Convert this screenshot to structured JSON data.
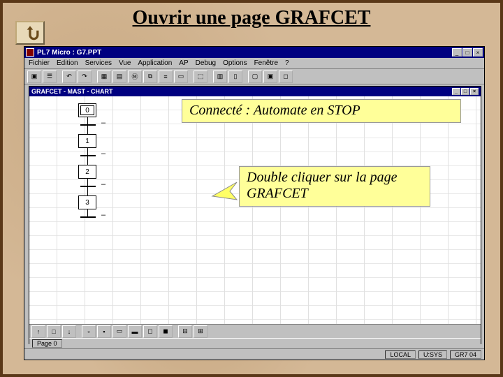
{
  "slide": {
    "title": "Ouvrir une page GRAFCET"
  },
  "window": {
    "title": "PL7 Micro : G7.PPT",
    "menu": [
      "Fichier",
      "Edition",
      "Services",
      "Vue",
      "Application",
      "AP",
      "Debug",
      "Options",
      "Fenêtre",
      "?"
    ]
  },
  "subwindow": {
    "title": "GRAFCET - MAST - CHART"
  },
  "grafcet": {
    "steps": [
      "0",
      "1",
      "2",
      "3"
    ]
  },
  "callouts": {
    "status": "Connecté : Automate en STOP",
    "hint": "Double cliquer sur la page GRAFCET"
  },
  "statusbar": {
    "page": "Page 0",
    "mode": "LOCAL",
    "sys": "U:SYS",
    "mem": "GR7 04"
  },
  "icons": {
    "min": "_",
    "max": "□",
    "close": "×"
  }
}
